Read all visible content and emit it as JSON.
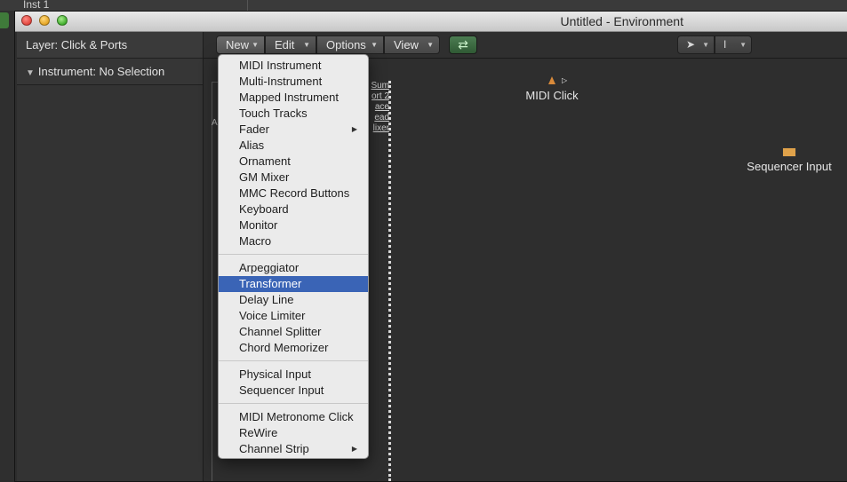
{
  "background": {
    "track_label": "Inst 1"
  },
  "window": {
    "title": "Untitled - Environment"
  },
  "inspector": {
    "layer": "Layer: Click & Ports",
    "instrument": "Instrument:  No Selection"
  },
  "toolbar": {
    "new_label": "New",
    "edit_label": "Edit",
    "options_label": "Options",
    "view_label": "View",
    "link_icon": "link-icon",
    "pointer_tool_icon": "pointer-icon",
    "text_tool_icon": "text-cursor-icon"
  },
  "canvas": {
    "mixer_labels": [
      "Sum",
      "ort 2",
      "ace",
      "ead",
      "lixer"
    ],
    "left_label": "A",
    "objects": {
      "midi_click": "MIDI Click",
      "sequencer_input": "Sequencer Input"
    }
  },
  "menu": {
    "groups": [
      {
        "items": [
          {
            "label": "MIDI Instrument"
          },
          {
            "label": "Multi-Instrument"
          },
          {
            "label": "Mapped Instrument"
          },
          {
            "label": "Touch Tracks"
          },
          {
            "label": "Fader",
            "submenu": true
          },
          {
            "label": "Alias"
          },
          {
            "label": "Ornament"
          },
          {
            "label": "GM Mixer"
          },
          {
            "label": "MMC Record Buttons"
          },
          {
            "label": "Keyboard"
          },
          {
            "label": "Monitor"
          },
          {
            "label": "Macro"
          }
        ]
      },
      {
        "items": [
          {
            "label": "Arpeggiator"
          },
          {
            "label": "Transformer",
            "selected": true
          },
          {
            "label": "Delay Line"
          },
          {
            "label": "Voice Limiter"
          },
          {
            "label": "Channel Splitter"
          },
          {
            "label": "Chord Memorizer"
          }
        ]
      },
      {
        "items": [
          {
            "label": "Physical Input"
          },
          {
            "label": "Sequencer Input"
          }
        ]
      },
      {
        "items": [
          {
            "label": "MIDI Metronome Click"
          },
          {
            "label": "ReWire"
          },
          {
            "label": "Channel Strip",
            "submenu": true
          }
        ]
      }
    ]
  },
  "colors": {
    "selection": "#3a64b6",
    "link_button": "#3f6e44",
    "sequencer_icon": "#e0a24a"
  }
}
